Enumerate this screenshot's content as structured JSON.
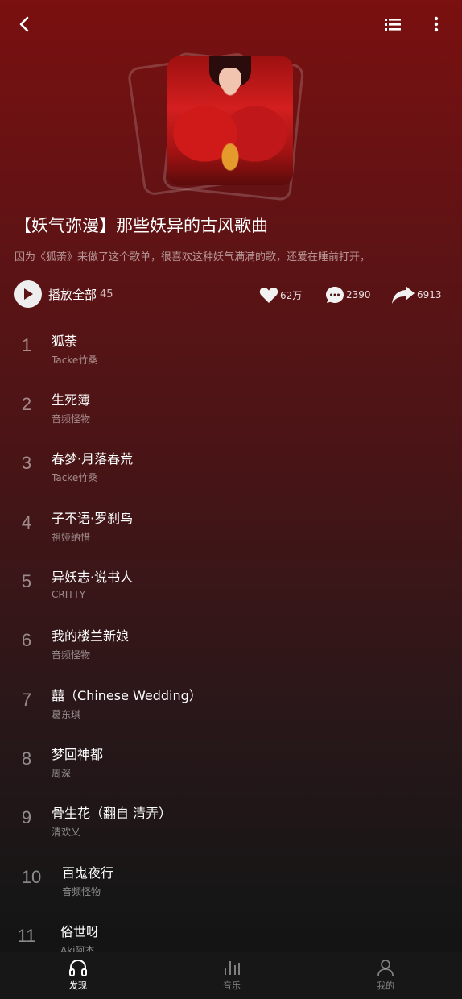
{
  "header": {
    "back_icon": "chevron-left-icon",
    "list_icon": "list-icon",
    "more_icon": "more-vertical-icon"
  },
  "playlist": {
    "title": "【妖气弥漫】那些妖异的古风歌曲",
    "description": "因为《狐荼》来做了这个歌单，很喜欢这种妖气满满的歌，还爱在睡前打开，",
    "play_all_label": "播放全部",
    "song_count": "45",
    "likes": "62万",
    "comments": "2390",
    "shares": "6913"
  },
  "songs": [
    {
      "num": "1",
      "name": "狐荼",
      "artist": "Tacke竹桑"
    },
    {
      "num": "2",
      "name": "生死簿",
      "artist": "音频怪物"
    },
    {
      "num": "3",
      "name": "春梦·月落春荒",
      "artist": "Tacke竹桑"
    },
    {
      "num": "4",
      "name": "子不语·罗刹鸟",
      "artist": "祖娅纳惜"
    },
    {
      "num": "5",
      "name": "异妖志·说书人",
      "artist": "CRITTY"
    },
    {
      "num": "6",
      "name": "我的楼兰新娘",
      "artist": "音频怪物"
    },
    {
      "num": "7",
      "name": "囍（Chinese Wedding）",
      "artist": "葛东琪"
    },
    {
      "num": "8",
      "name": "梦回神都",
      "artist": "周深"
    },
    {
      "num": "9",
      "name": "骨生花（翻自 清弄）",
      "artist": "清欢乂"
    },
    {
      "num": "10",
      "name": "百鬼夜行",
      "artist": "音频怪物"
    },
    {
      "num": "11",
      "name": "俗世呀",
      "artist": "Aki阿杰"
    }
  ],
  "tabbar": {
    "discover": "发现",
    "music": "音乐",
    "mine": "我的"
  },
  "colors": {
    "top_gradient": "#7a1010",
    "bottom": "#111111",
    "tabbar_bg": "#171717"
  }
}
